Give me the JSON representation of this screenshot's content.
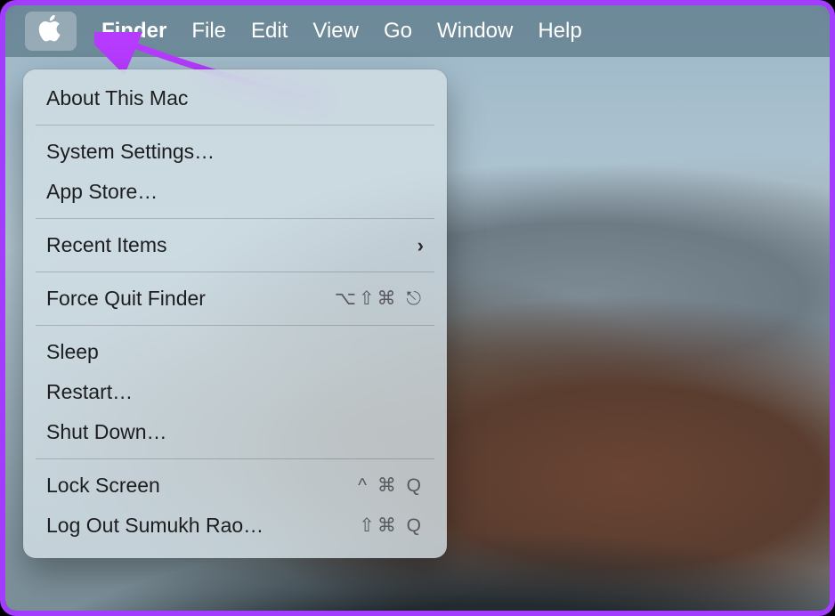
{
  "menubar": {
    "app": "Finder",
    "items": [
      "File",
      "Edit",
      "View",
      "Go",
      "Window",
      "Help"
    ]
  },
  "menu": {
    "about": "About This Mac",
    "settings": "System Settings…",
    "appstore": "App Store…",
    "recent": "Recent Items",
    "forcequit": "Force Quit Finder",
    "forcequit_shortcut": "⌥⇧⌘ ⎋",
    "sleep": "Sleep",
    "restart": "Restart…",
    "shutdown": "Shut Down…",
    "lock": "Lock Screen",
    "lock_shortcut": "^ ⌘ Q",
    "logout": "Log Out Sumukh Rao…",
    "logout_shortcut": "⇧⌘ Q"
  }
}
